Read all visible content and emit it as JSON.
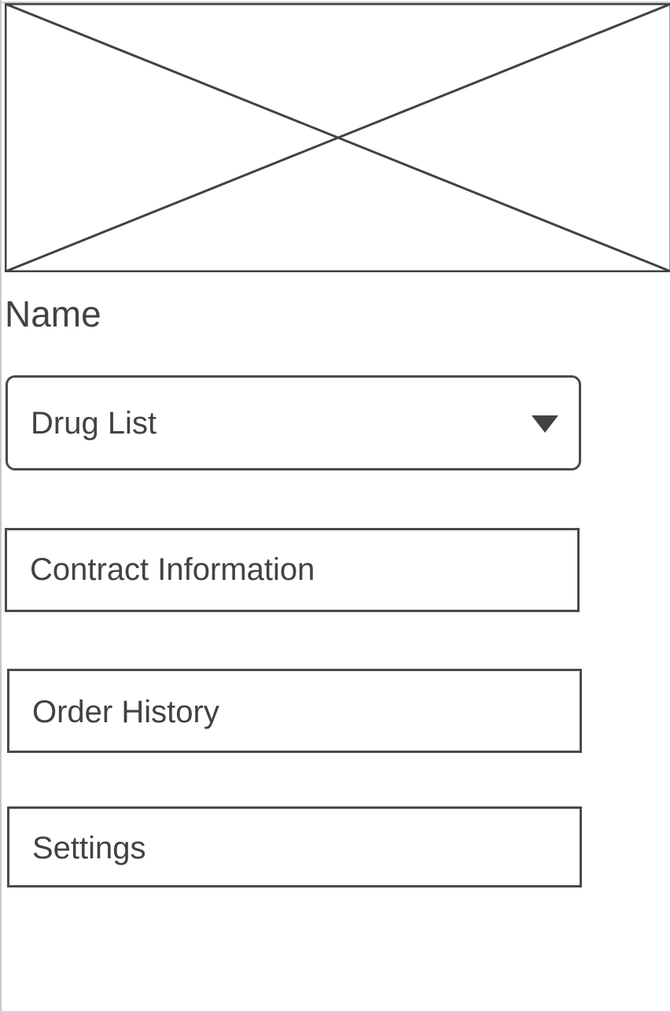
{
  "profile": {
    "image_placeholder_icon": "image-placeholder-icon",
    "name_label": "Name"
  },
  "menu": {
    "drug_list_label": "Drug List",
    "contract_information_label": "Contract Information",
    "order_history_label": "Order History",
    "settings_label": "Settings"
  },
  "colors": {
    "stroke": "#424242",
    "background": "#ffffff",
    "frame_border": "#c8c8c8"
  }
}
